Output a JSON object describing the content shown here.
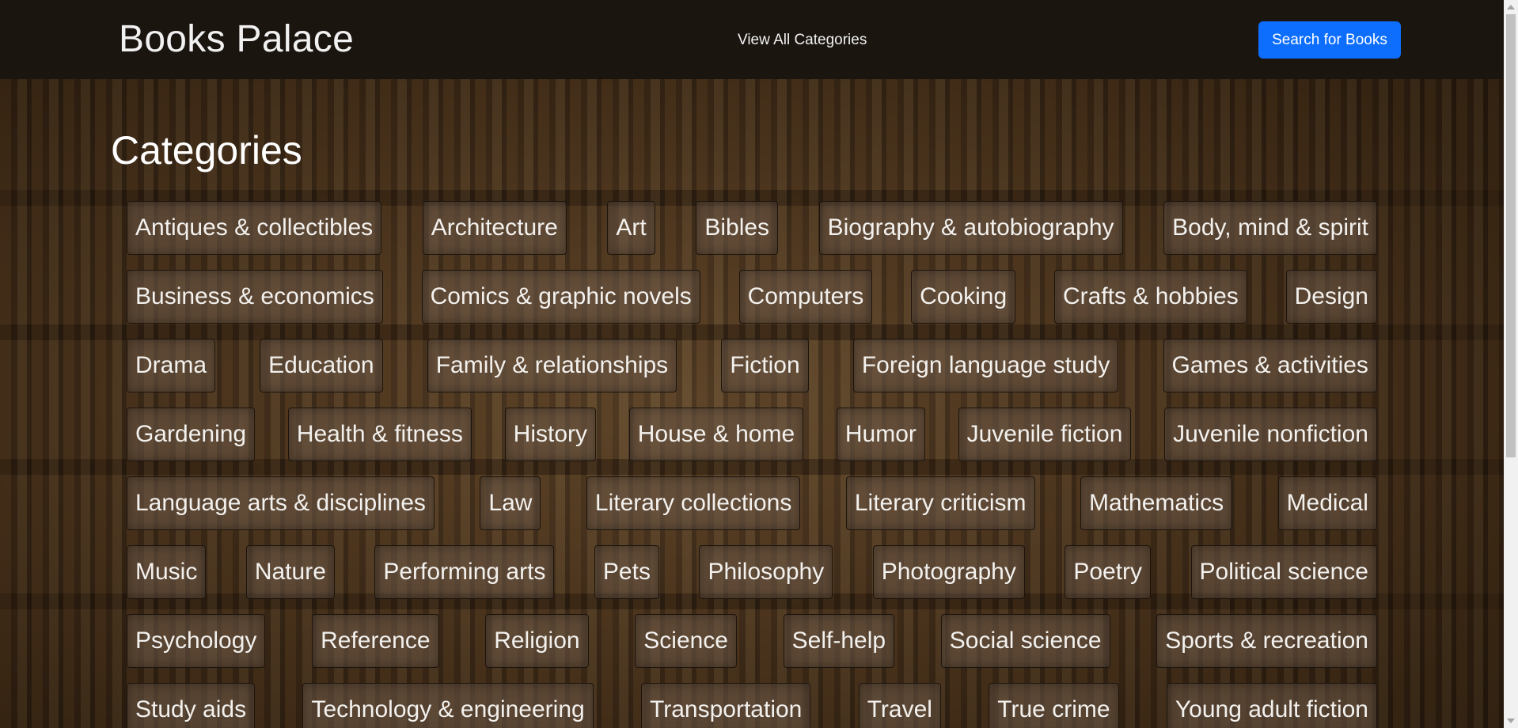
{
  "navbar": {
    "brand": "Books Palace",
    "view_all_label": "View All Categories",
    "search_label": "Search for Books"
  },
  "main": {
    "heading": "Categories",
    "category_rows": [
      [
        "Antiques & collectibles",
        "Architecture",
        "Art",
        "Bibles",
        "Biography & autobiography",
        "Body, mind & spirit"
      ],
      [
        "Business & economics",
        "Comics & graphic novels",
        "Computers",
        "Cooking",
        "Crafts & hobbies",
        "Design"
      ],
      [
        "Drama",
        "Education",
        "Family & relationships",
        "Fiction",
        "Foreign language study",
        "Games & activities"
      ],
      [
        "Gardening",
        "Health & fitness",
        "History",
        "House & home",
        "Humor",
        "Juvenile fiction",
        "Juvenile nonfiction"
      ],
      [
        "Language arts & disciplines",
        "Law",
        "Literary collections",
        "Literary criticism",
        "Mathematics",
        "Medical"
      ],
      [
        "Music",
        "Nature",
        "Performing arts",
        "Pets",
        "Philosophy",
        "Photography",
        "Poetry",
        "Political science"
      ],
      [
        "Psychology",
        "Reference",
        "Religion",
        "Science",
        "Self-help",
        "Social science",
        "Sports & recreation"
      ],
      [
        "Study aids",
        "Technology & engineering",
        "Transportation",
        "Travel",
        "True crime",
        "Young adult fiction"
      ]
    ]
  },
  "icons": {
    "scroll_up": "chevron-up-icon",
    "scroll_down": "chevron-down-icon"
  },
  "colors": {
    "navbar_bg": "#1b1510",
    "primary_button": "#0d6efd",
    "text": "#f3f1ee"
  }
}
